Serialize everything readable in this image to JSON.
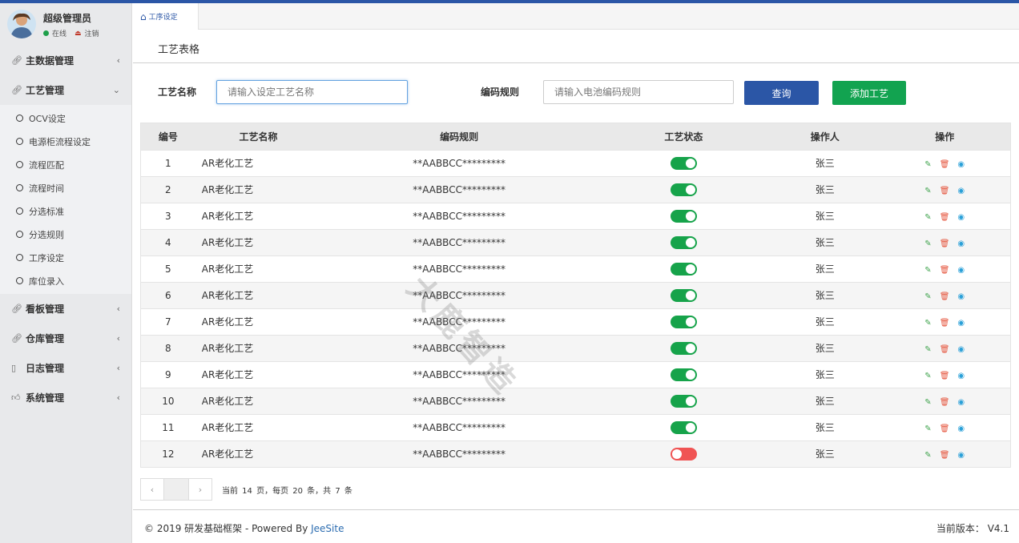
{
  "user": {
    "name": "超级管理员",
    "status": "在线",
    "logout": "注销"
  },
  "sidebar": {
    "menus": [
      {
        "label": "主数据管理",
        "icon": "link-icon",
        "arrow": "‹"
      },
      {
        "label": "工艺管理",
        "icon": "link-icon",
        "arrow": "⌄"
      }
    ],
    "sub_items": [
      "OCV设定",
      "电源柜流程设定",
      "流程匹配",
      "流程时间",
      "分选标准",
      "分选规则",
      "工序设定",
      "库位录入"
    ],
    "menus_after": [
      {
        "label": "看板管理",
        "icon": "link-icon",
        "arrow": "‹"
      },
      {
        "label": "仓库管理",
        "icon": "link-icon",
        "arrow": "‹"
      },
      {
        "label": "日志管理",
        "icon": "book-icon",
        "arrow": "‹"
      },
      {
        "label": "系统管理",
        "icon": "thumbs-up-icon",
        "arrow": "‹"
      }
    ]
  },
  "tab": {
    "label": "工序设定"
  },
  "page": {
    "title": "工艺表格"
  },
  "filters": {
    "name_label": "工艺名称",
    "name_placeholder": "请输入设定工艺名称",
    "code_label": "编码规则",
    "code_placeholder": "请输入电池编码规则",
    "query_button": "查询",
    "add_button": "添加工艺"
  },
  "table": {
    "headers": [
      "编号",
      "工艺名称",
      "编码规则",
      "工艺状态",
      "操作人",
      "操作"
    ],
    "rows": [
      {
        "id": "1",
        "name": "AR老化工艺",
        "code": "**AABBCC*********",
        "enabled": true,
        "operator": "张三"
      },
      {
        "id": "2",
        "name": "AR老化工艺",
        "code": "**AABBCC*********",
        "enabled": true,
        "operator": "张三"
      },
      {
        "id": "3",
        "name": "AR老化工艺",
        "code": "**AABBCC*********",
        "enabled": true,
        "operator": "张三"
      },
      {
        "id": "4",
        "name": "AR老化工艺",
        "code": "**AABBCC*********",
        "enabled": true,
        "operator": "张三"
      },
      {
        "id": "5",
        "name": "AR老化工艺",
        "code": "**AABBCC*********",
        "enabled": true,
        "operator": "张三"
      },
      {
        "id": "6",
        "name": "AR老化工艺",
        "code": "**AABBCC*********",
        "enabled": true,
        "operator": "张三"
      },
      {
        "id": "7",
        "name": "AR老化工艺",
        "code": "**AABBCC*********",
        "enabled": true,
        "operator": "张三"
      },
      {
        "id": "8",
        "name": "AR老化工艺",
        "code": "**AABBCC*********",
        "enabled": true,
        "operator": "张三"
      },
      {
        "id": "9",
        "name": "AR老化工艺",
        "code": "**AABBCC*********",
        "enabled": true,
        "operator": "张三"
      },
      {
        "id": "10",
        "name": "AR老化工艺",
        "code": "**AABBCC*********",
        "enabled": true,
        "operator": "张三"
      },
      {
        "id": "11",
        "name": "AR老化工艺",
        "code": "**AABBCC*********",
        "enabled": true,
        "operator": "张三"
      },
      {
        "id": "12",
        "name": "AR老化工艺",
        "code": "**AABBCC*********",
        "enabled": false,
        "operator": "张三"
      }
    ],
    "actions": [
      "pencil-icon",
      "trash-icon",
      "eye-icon"
    ]
  },
  "pagination": {
    "prev": "‹",
    "next": "›",
    "info": "当前 14 页，每页 20 条，共 7 条"
  },
  "footer": {
    "copyright": "© 2019 研发基础框架 - Powered By ",
    "link": "JeeSite",
    "version": "当前版本： V4.1"
  },
  "watermark": "大鹿智造",
  "colors": {
    "primary": "#2b56a6",
    "success": "#12a350",
    "toggle_on": "#16a34a",
    "toggle_off": "#f05454"
  }
}
